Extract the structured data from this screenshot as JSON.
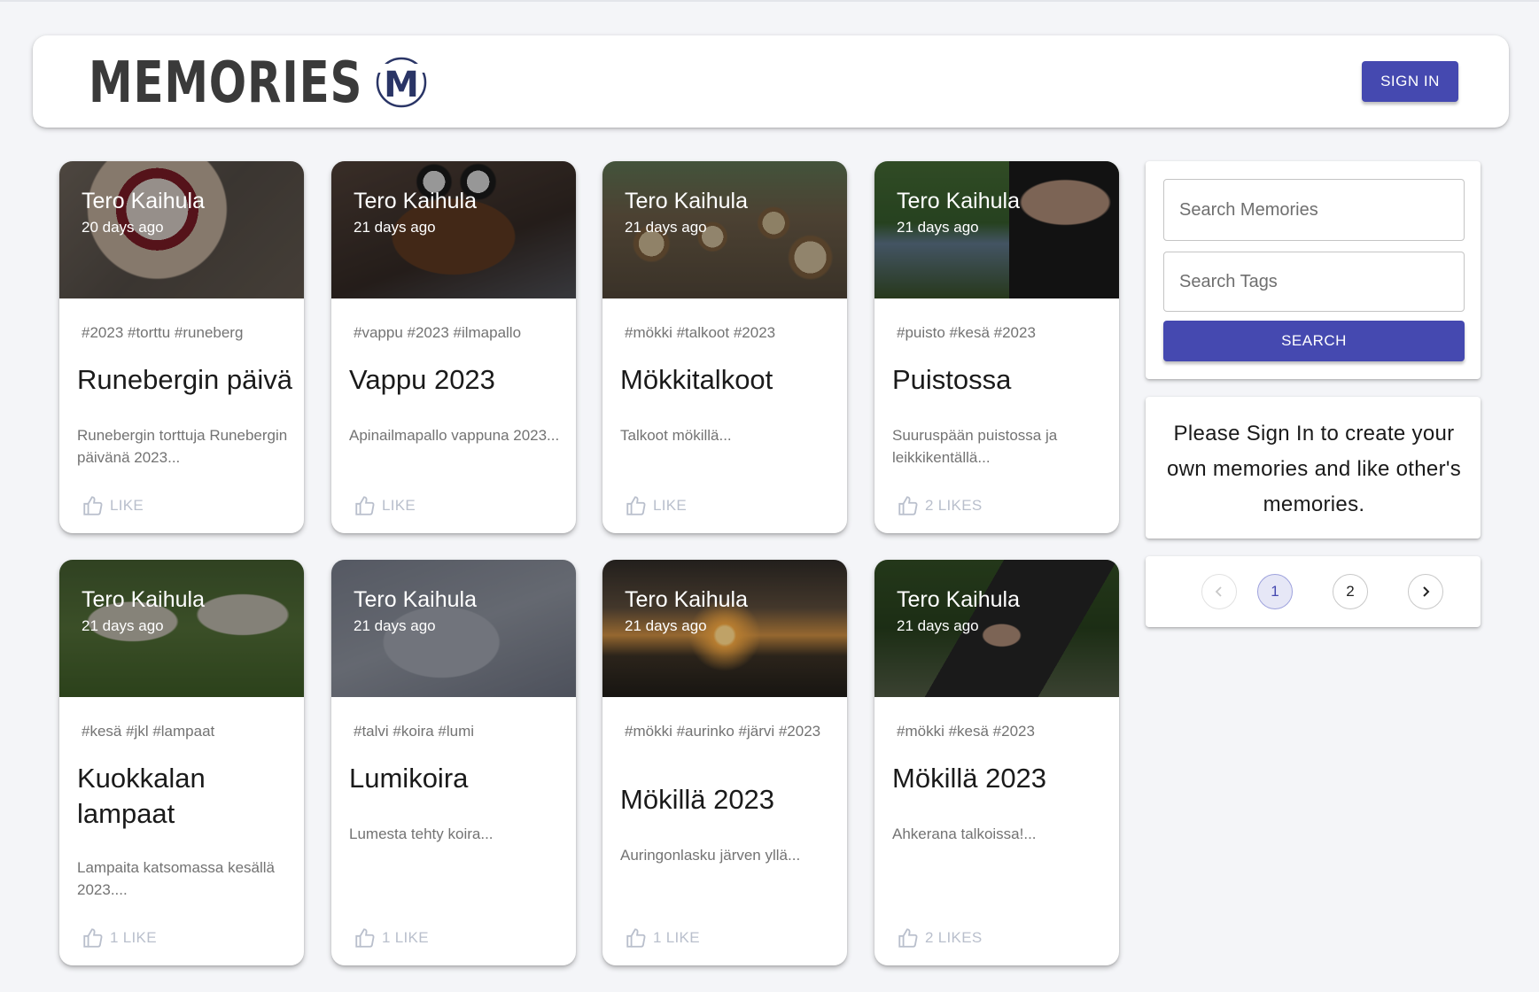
{
  "header": {
    "brand": "Memories",
    "logo_letter": "M",
    "signin_label": "SIGN IN"
  },
  "posts": [
    {
      "author": "Tero Kaihula",
      "time": "20 days ago",
      "tags": "#2023 #torttu #runeberg",
      "title": "Runebergin päivä",
      "message": "Runebergin torttuja Runebergin päivänä 2023...",
      "likes": "LIKE",
      "image_theme": "pastry"
    },
    {
      "author": "Tero Kaihula",
      "time": "21 days ago",
      "tags": "#vappu #2023 #ilmapallo",
      "title": "Vappu 2023",
      "message": "Apinailmapallo vappuna 2023...",
      "likes": "LIKE",
      "image_theme": "balloon"
    },
    {
      "author": "Tero Kaihula",
      "time": "21 days ago",
      "tags": "#mökki #talkoot #2023",
      "title": "Mökkitalkoot",
      "message": "Talkoot mökillä...",
      "likes": "LIKE",
      "image_theme": "logs"
    },
    {
      "author": "Tero Kaihula",
      "time": "21 days ago",
      "tags": "#puisto #kesä #2023",
      "title": "Puistossa",
      "message": "Suuruspään puistossa ja leikkikentällä...",
      "likes": "2 LIKES",
      "image_theme": "park"
    },
    {
      "author": "Tero Kaihula",
      "time": "21 days ago",
      "tags": "#kesä #jkl #lampaat",
      "title": "Kuokkalan lampaat",
      "message": "Lampaita katsomassa kesällä 2023....",
      "likes": "1 LIKE",
      "image_theme": "sheep"
    },
    {
      "author": "Tero Kaihula",
      "time": "21 days ago",
      "tags": "#talvi #koira #lumi",
      "title": "Lumikoira",
      "message": "Lumesta tehty koira...",
      "likes": "1 LIKE",
      "image_theme": "snow"
    },
    {
      "author": "Tero Kaihula",
      "time": "21 days ago",
      "tags": "#mökki #aurinko #järvi #2023",
      "title": "Mökillä 2023",
      "message": "Auringonlasku järven yllä...",
      "likes": "1 LIKE",
      "image_theme": "sunset"
    },
    {
      "author": "Tero Kaihula",
      "time": "21 days ago",
      "tags": "#mökki #kesä #2023",
      "title": "Mökillä 2023",
      "message": "Ahkerana talkoissa!...",
      "likes": "2 LIKES",
      "image_theme": "forest"
    }
  ],
  "search": {
    "memories_placeholder": "Search Memories",
    "tags_placeholder": "Search Tags",
    "button_label": "SEARCH"
  },
  "notice": {
    "text": "Please Sign In to create your own memories and like other's memories."
  },
  "pagination": {
    "pages": [
      "1",
      "2"
    ],
    "current": "1"
  },
  "colors": {
    "primary": "#4549b0",
    "background": "#f4f5f8",
    "muted_text": "#737373",
    "like_text": "#b9bfcc"
  }
}
